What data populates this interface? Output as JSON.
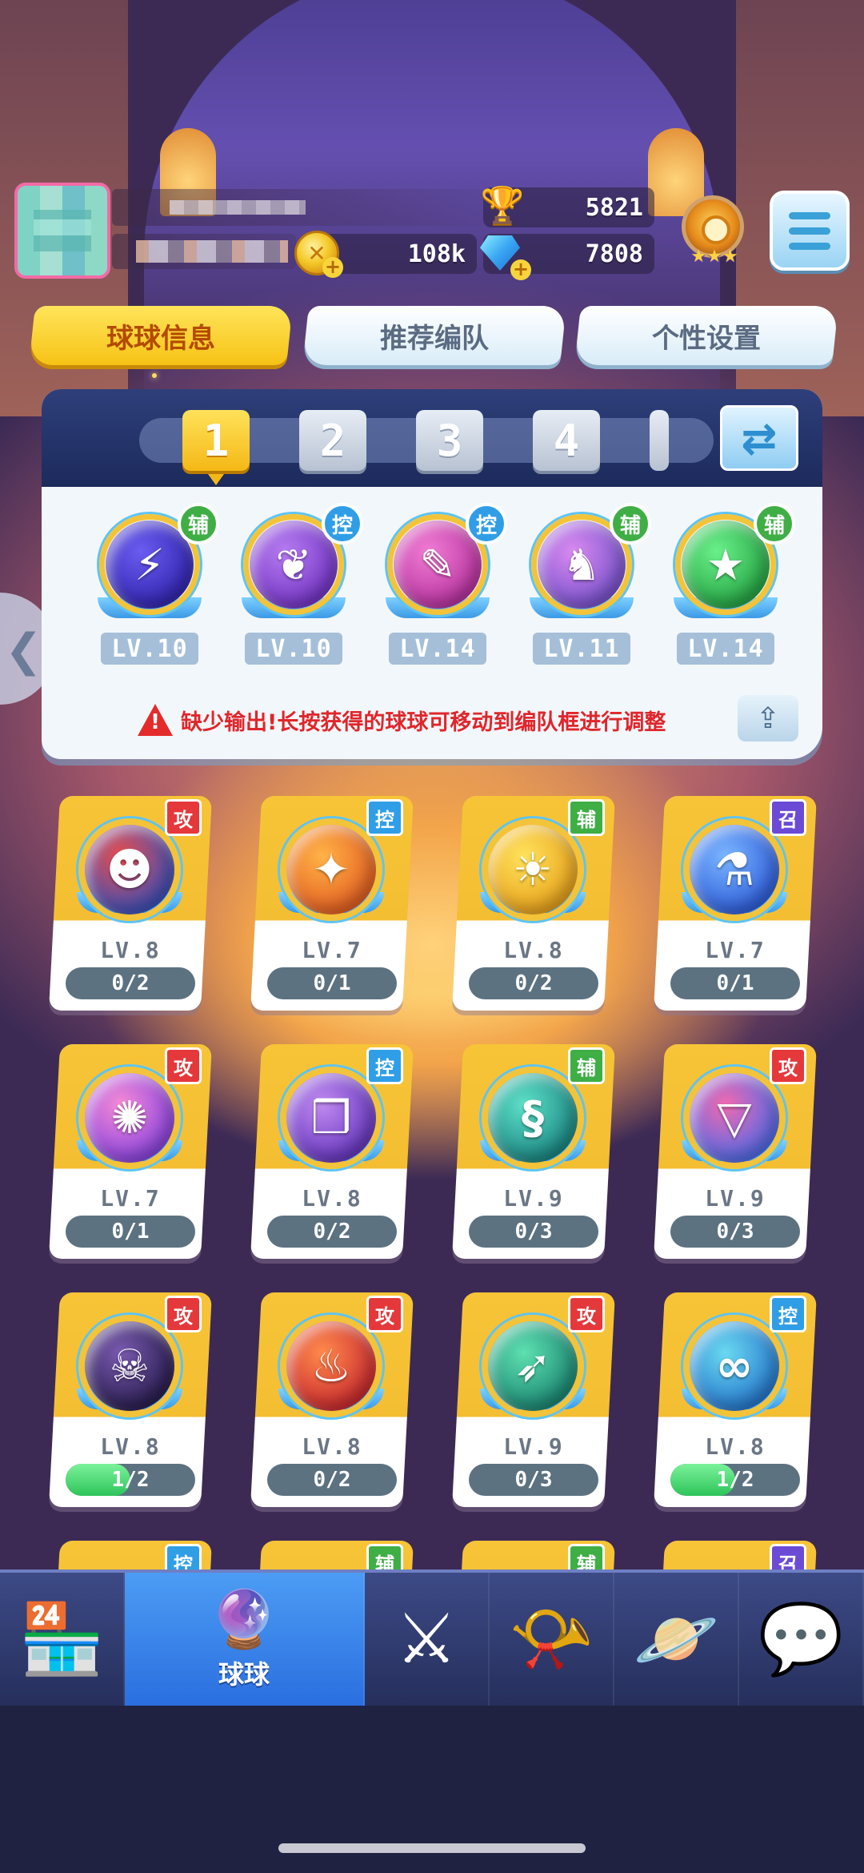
{
  "player": {
    "trophies": "5821",
    "coins": "108k",
    "gems": "7808",
    "rank_stars": "★★★"
  },
  "tabs": [
    {
      "label": "球球信息",
      "active": true
    },
    {
      "label": "推荐编队",
      "active": false
    },
    {
      "label": "个性设置",
      "active": false
    }
  ],
  "lineup": {
    "slots": [
      "1",
      "2",
      "3",
      "4"
    ],
    "active_slot": "1",
    "balls": [
      {
        "role": "辅",
        "role_color": "#3fae45",
        "level": "LV.10",
        "colors": [
          "#6a5cf0",
          "#2b1ea8"
        ],
        "glyph": "⚡"
      },
      {
        "role": "控",
        "role_color": "#2f9ee6",
        "level": "LV.10",
        "colors": [
          "#b67cf0",
          "#6b2bc0"
        ],
        "glyph": "❦"
      },
      {
        "role": "控",
        "role_color": "#2f9ee6",
        "level": "LV.14",
        "colors": [
          "#f07cd4",
          "#b02898"
        ],
        "glyph": "✎"
      },
      {
        "role": "辅",
        "role_color": "#3fae45",
        "level": "LV.11",
        "colors": [
          "#d98af0",
          "#6b4ac8"
        ],
        "glyph": "♞"
      },
      {
        "role": "辅",
        "role_color": "#3fae45",
        "level": "LV.14",
        "colors": [
          "#6af08a",
          "#1c9a3a"
        ],
        "glyph": "★"
      }
    ],
    "warning": "缺少输出!长按获得的球球可移动到编队框进行调整"
  },
  "cards": [
    {
      "role": "攻",
      "role_color": "#e5383b",
      "level": "LV.8",
      "progress": "0/2",
      "fill": 0,
      "colors": [
        "#e84d4d",
        "#2250c8"
      ],
      "glyph": "☻"
    },
    {
      "role": "控",
      "role_color": "#2f9ee6",
      "level": "LV.7",
      "progress": "0/1",
      "fill": 0,
      "colors": [
        "#ffb347",
        "#e0541c"
      ],
      "glyph": "✦"
    },
    {
      "role": "辅",
      "role_color": "#3fae45",
      "level": "LV.8",
      "progress": "0/2",
      "fill": 0,
      "colors": [
        "#ffe25c",
        "#e69a12"
      ],
      "glyph": "☀"
    },
    {
      "role": "召",
      "role_color": "#6b4ad6",
      "level": "LV.7",
      "progress": "0/1",
      "fill": 0,
      "colors": [
        "#7ab6ff",
        "#2552d6"
      ],
      "glyph": "⚗"
    },
    {
      "role": "攻",
      "role_color": "#e5383b",
      "level": "LV.7",
      "progress": "0/1",
      "fill": 0,
      "colors": [
        "#f58ad6",
        "#7b3ae0"
      ],
      "glyph": "✺"
    },
    {
      "role": "控",
      "role_color": "#2f9ee6",
      "level": "LV.8",
      "progress": "0/2",
      "fill": 0,
      "colors": [
        "#c08af0",
        "#5a2bb8"
      ],
      "glyph": "❒"
    },
    {
      "role": "辅",
      "role_color": "#3fae45",
      "level": "LV.9",
      "progress": "0/3",
      "fill": 0,
      "colors": [
        "#5ee0c8",
        "#117a78"
      ],
      "glyph": "§"
    },
    {
      "role": "攻",
      "role_color": "#e5383b",
      "level": "LV.9",
      "progress": "0/3",
      "fill": 0,
      "colors": [
        "#f06ab0",
        "#3a6af0"
      ],
      "glyph": "▽"
    },
    {
      "role": "攻",
      "role_color": "#e5383b",
      "level": "LV.8",
      "progress": "1/2",
      "fill": 0.5,
      "colors": [
        "#7a5ab0",
        "#1c1440"
      ],
      "glyph": "☠"
    },
    {
      "role": "攻",
      "role_color": "#e5383b",
      "level": "LV.8",
      "progress": "0/2",
      "fill": 0,
      "colors": [
        "#ff8a4c",
        "#c21c2a"
      ],
      "glyph": "♨"
    },
    {
      "role": "攻",
      "role_color": "#e5383b",
      "level": "LV.9",
      "progress": "0/3",
      "fill": 0,
      "colors": [
        "#5ee0b0",
        "#127a6a"
      ],
      "glyph": "➶"
    },
    {
      "role": "控",
      "role_color": "#2f9ee6",
      "level": "LV.8",
      "progress": "1/2",
      "fill": 0.5,
      "colors": [
        "#6ad8f0",
        "#1c6ac8"
      ],
      "glyph": "∞"
    },
    {
      "role": "控",
      "role_color": "#2f9ee6"
    },
    {
      "role": "辅",
      "role_color": "#3fae45"
    },
    {
      "role": "辅",
      "role_color": "#3fae45"
    },
    {
      "role": "召",
      "role_color": "#6b4ad6"
    }
  ],
  "nav": [
    {
      "name": "shop",
      "icon": "shop-icon",
      "glyph": "🏪",
      "label": ""
    },
    {
      "name": "balls",
      "icon": "ball-icon",
      "glyph": "🔮",
      "label": "球球",
      "active": true
    },
    {
      "name": "battle",
      "icon": "crossed-swords-icon",
      "glyph": "⚔",
      "label": ""
    },
    {
      "name": "whistle",
      "icon": "whistle-icon",
      "glyph": "📯",
      "label": ""
    },
    {
      "name": "planet",
      "icon": "planet-icon",
      "glyph": "🪐",
      "label": ""
    },
    {
      "name": "social",
      "icon": "chat-heart-icon",
      "glyph": "💬",
      "label": ""
    }
  ]
}
